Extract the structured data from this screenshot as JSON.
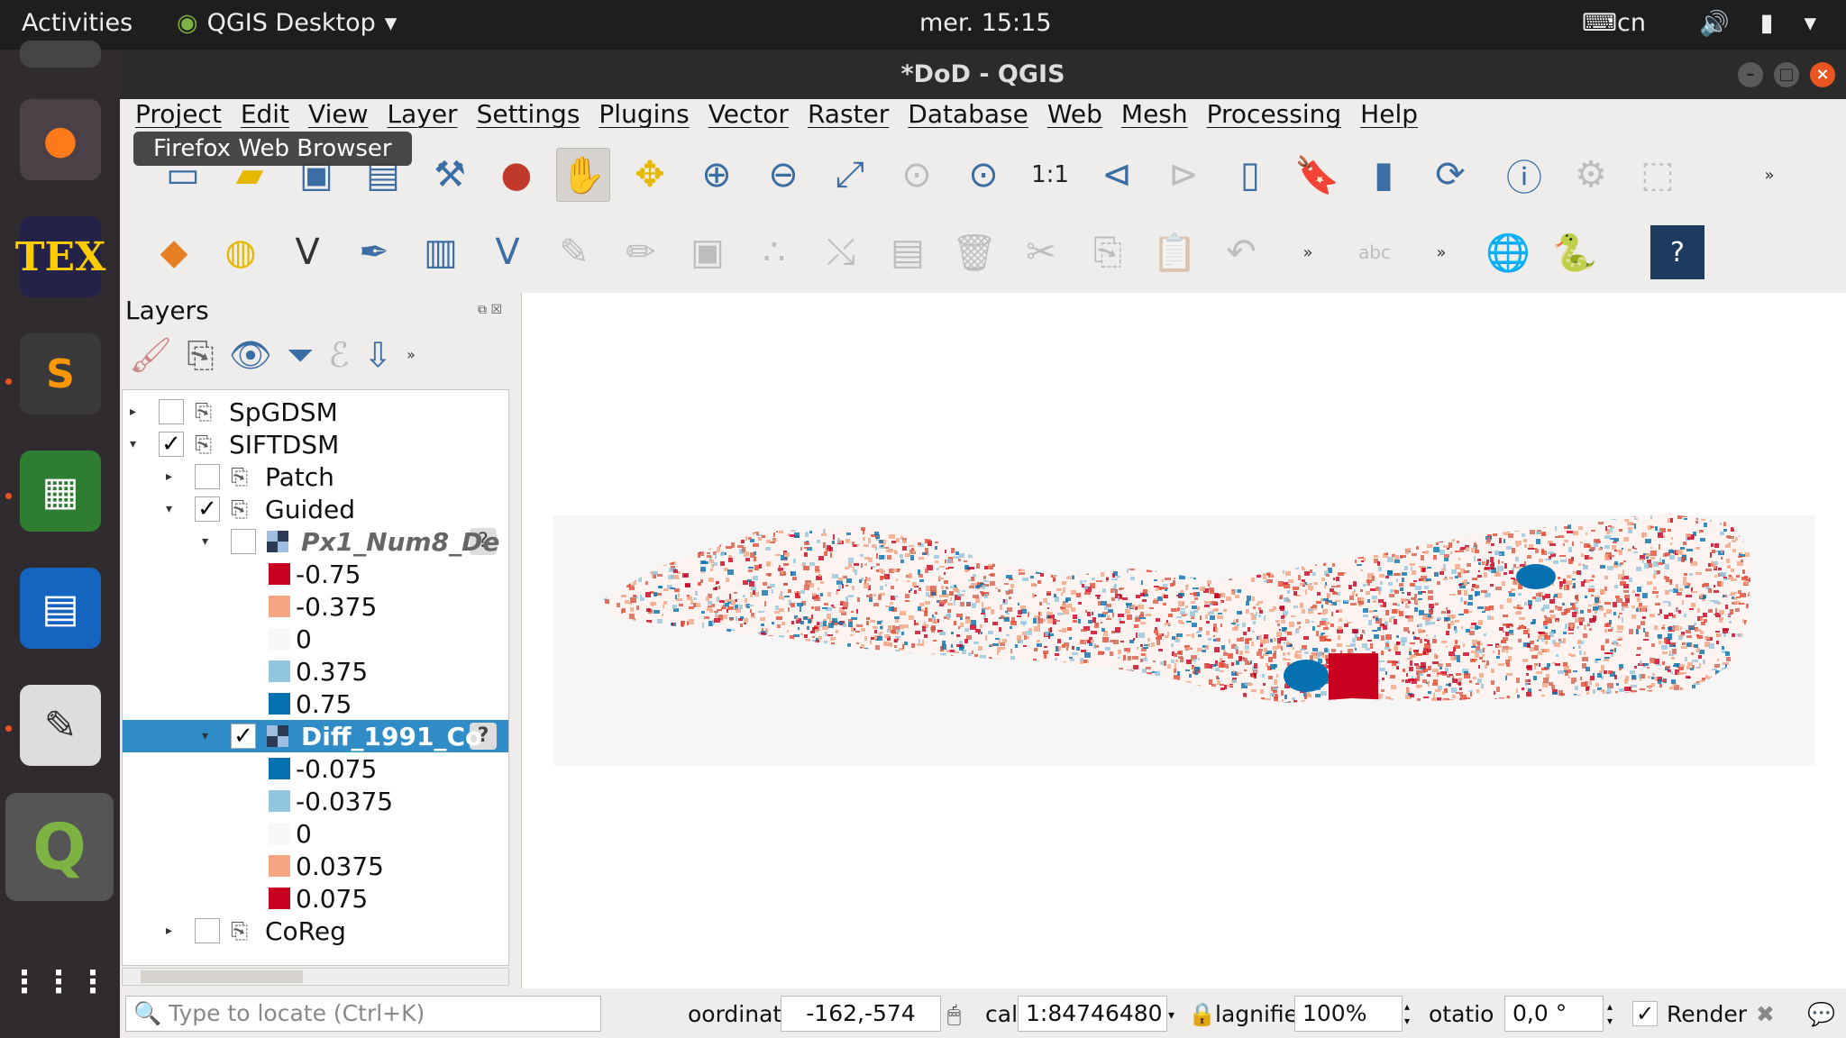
{
  "topbar": {
    "activities": "Activities",
    "app": "QGIS Desktop",
    "clock": "mer. 15:15",
    "keyboard": "cn"
  },
  "window": {
    "title": "*DoD - QGIS"
  },
  "tooltip": "Firefox Web Browser",
  "menu": [
    "Project",
    "Edit",
    "View",
    "Layer",
    "Settings",
    "Plugins",
    "Vector",
    "Raster",
    "Database",
    "Web",
    "Mesh",
    "Processing",
    "Help"
  ],
  "layers_panel": {
    "title": "Layers",
    "tree": [
      {
        "label": "SpGDSM",
        "checked": false,
        "expanded": false,
        "level": 0,
        "kind": "group"
      },
      {
        "label": "SIFTDSM",
        "checked": true,
        "expanded": true,
        "level": 0,
        "kind": "group"
      },
      {
        "label": "Patch",
        "checked": false,
        "expanded": false,
        "level": 1,
        "kind": "group"
      },
      {
        "label": "Guided",
        "checked": true,
        "expanded": true,
        "level": 1,
        "kind": "group"
      },
      {
        "label": "Px1_Num8_De",
        "checked": false,
        "expanded": true,
        "level": 2,
        "kind": "raster",
        "italic": true
      },
      {
        "label": "-0.75",
        "color": "#ca0020",
        "level": 3,
        "kind": "legend"
      },
      {
        "label": "-0.375",
        "color": "#f4a582",
        "level": 3,
        "kind": "legend"
      },
      {
        "label": "0",
        "color": "#f7f7f7",
        "level": 3,
        "kind": "legend"
      },
      {
        "label": "0.375",
        "color": "#92c5de",
        "level": 3,
        "kind": "legend"
      },
      {
        "label": "0.75",
        "color": "#0571b0",
        "level": 3,
        "kind": "legend"
      },
      {
        "label": "Diff_1991_Co",
        "checked": true,
        "expanded": true,
        "level": 2,
        "kind": "raster",
        "selected": true
      },
      {
        "label": "-0.075",
        "color": "#0571b0",
        "level": 3,
        "kind": "legend"
      },
      {
        "label": "-0.0375",
        "color": "#92c5de",
        "level": 3,
        "kind": "legend"
      },
      {
        "label": "0",
        "color": "#f7f7f7",
        "level": 3,
        "kind": "legend"
      },
      {
        "label": "0.0375",
        "color": "#f4a582",
        "level": 3,
        "kind": "legend"
      },
      {
        "label": "0.075",
        "color": "#ca0020",
        "level": 3,
        "kind": "legend"
      },
      {
        "label": "CoReg",
        "checked": false,
        "expanded": false,
        "level": 1,
        "kind": "group"
      }
    ]
  },
  "status": {
    "locate_placeholder": "Type to locate (Ctrl+K)",
    "coordinate_label": "oordinat",
    "coordinate": "-162,-574",
    "scale_label": "cal",
    "scale": "1:84746480",
    "magnifier_label": "lagnifie",
    "magnifier": "100%",
    "rotation_label": "otatio",
    "rotation": "0,0 °",
    "render_label": "Render",
    "render_checked": true
  }
}
